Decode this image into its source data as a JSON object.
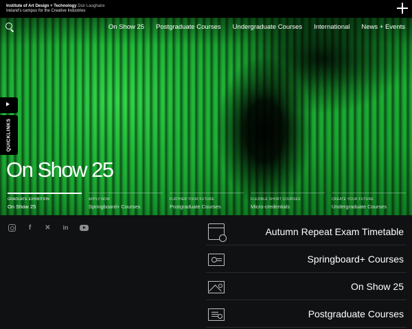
{
  "header": {
    "logo_line1": "Institute of Art Design + Technology",
    "logo_line1_sub": "Dún Laoghaire",
    "logo_line2": "Ireland's campus for the Creative Industries"
  },
  "nav": {
    "items": [
      "On Show 25",
      "Postgraduate Courses",
      "Undergraduate Courses",
      "International",
      "News + Events"
    ]
  },
  "quicklinks_label": "QUICKLINKS",
  "hero": {
    "title": "On Show 25",
    "links": [
      {
        "kicker": "GRADUATE EXHIBITION",
        "title": "On Show 25",
        "active": true
      },
      {
        "kicker": "APPLY NOW",
        "title": "Springboard+ Courses",
        "active": false
      },
      {
        "kicker": "FURTHER YOUR FUTURE",
        "title": "Postgraduate Courses",
        "active": false
      },
      {
        "kicker": "FLEXIBLE SHORT COURSES",
        "title": "Micro-credentials",
        "active": false
      },
      {
        "kicker": "CREATE YOUR FUTURE",
        "title": "Undergraduate Courses",
        "active": false
      }
    ]
  },
  "social": {
    "icons": [
      "instagram-icon",
      "facebook-icon",
      "x-icon",
      "linkedin-icon",
      "youtube-icon"
    ]
  },
  "quick_list": {
    "items": [
      {
        "label": "Autumn Repeat Exam Timetable",
        "icon": "calendar-clock-icon"
      },
      {
        "label": "Springboard+ Courses",
        "icon": "presentation-icon"
      },
      {
        "label": "On Show 25",
        "icon": "image-icon"
      },
      {
        "label": "Postgraduate Courses",
        "icon": "certificate-icon"
      }
    ]
  },
  "colors": {
    "accent_green": "#1fb638",
    "background_dark": "#0f1112",
    "topbar": "#000000"
  }
}
